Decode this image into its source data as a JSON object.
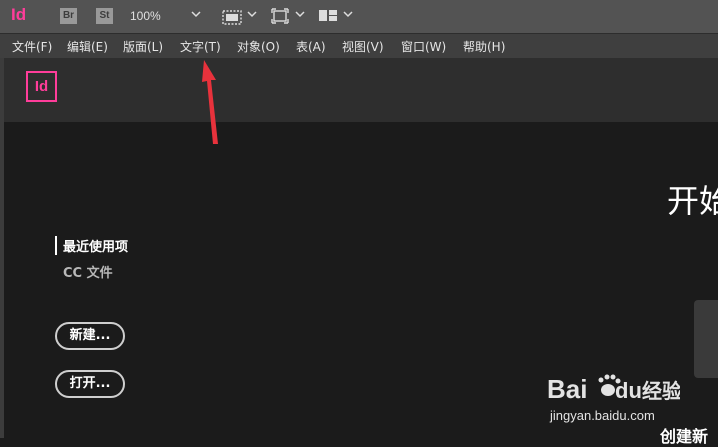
{
  "app": {
    "logo_text": "Id",
    "bridge_label": "Br",
    "stock_label": "St",
    "zoom_level": "100%"
  },
  "menu": {
    "items": [
      "文件(F)",
      "编辑(E)",
      "版面(L)",
      "文字(T)",
      "对象(O)",
      "表(A)",
      "视图(V)",
      "窗口(W)",
      "帮助(H)"
    ]
  },
  "home": {
    "logo_text": "Id",
    "title": "开始",
    "nav": {
      "recent": "最近使用项",
      "cc_files": "CC 文件"
    },
    "buttons": {
      "new": "新建...",
      "open": "打开..."
    },
    "right_text": "创建新"
  },
  "watermark": {
    "brand": "Bai",
    "brand2": "du",
    "service": "经验",
    "url": "jingyan.baidu.com"
  },
  "colors": {
    "accent": "#ff3d9a",
    "arrow": "#e8323c"
  }
}
